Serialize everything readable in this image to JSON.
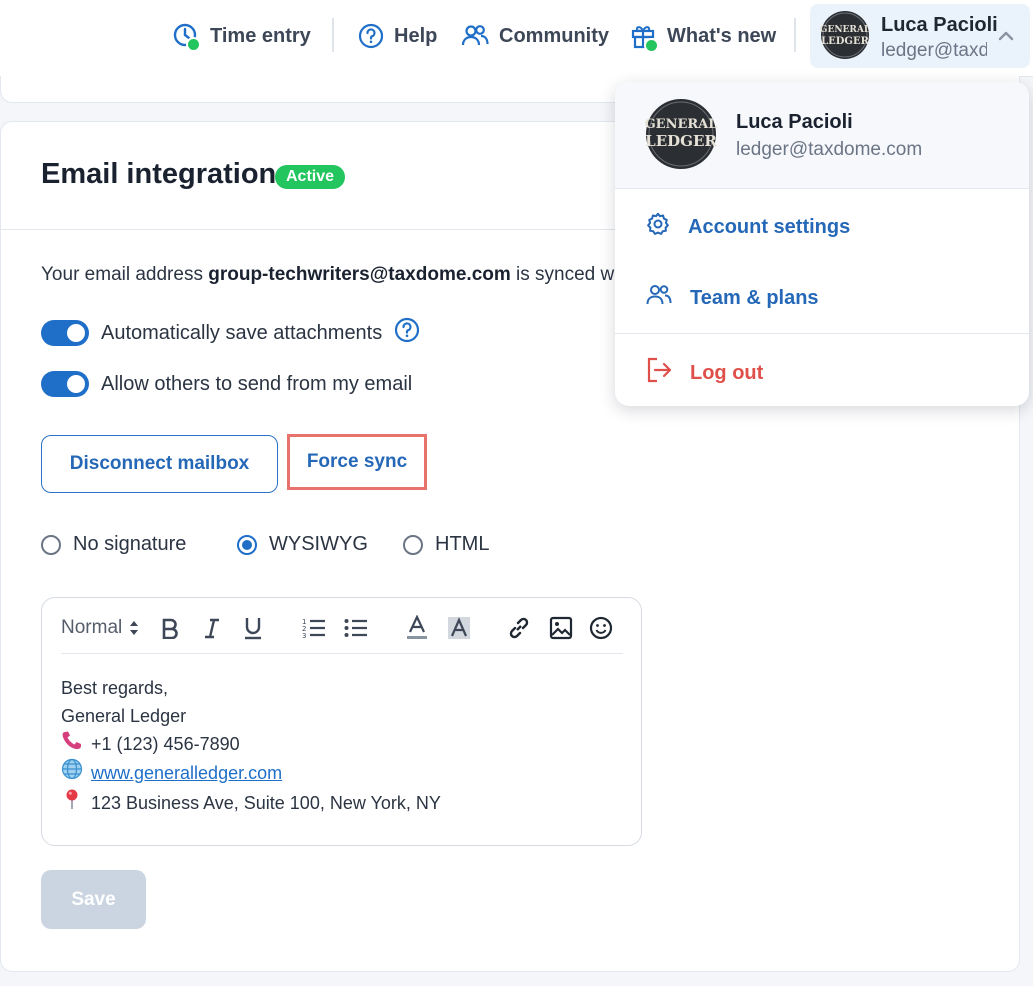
{
  "topbar": {
    "time_entry": "Time entry",
    "help": "Help",
    "community": "Community",
    "whats_new": "What's new",
    "user_name": "Luca Pacioli",
    "user_email": "ledger@taxdome.com",
    "avatar_text_top": "GENERAL",
    "avatar_text_bottom": "LEDGER"
  },
  "email_integration": {
    "title": "Email integration",
    "badge": "Active",
    "synced_prefix": "Your email address ",
    "synced_email": "group-techwriters@taxdome.com",
    "synced_suffix": " is synced w",
    "toggle_save_attachments": "Automatically save attachments",
    "toggle_allow_others": "Allow others to send from my email",
    "disconnect_button": "Disconnect mailbox",
    "force_sync_button": "Force sync",
    "signature_options": [
      "No signature",
      "WYSIWYG",
      "HTML"
    ],
    "selected_signature": "WYSIWYG",
    "save_button": "Save"
  },
  "editor": {
    "format_select": "Normal",
    "lines": {
      "greeting": "Best regards,",
      "company": "General Ledger",
      "phone": "+1 (123) 456-7890",
      "website": "www.generalledger.com",
      "address": "123 Business Ave, Suite 100, New York, NY"
    }
  },
  "dropdown": {
    "name": "Luca Pacioli",
    "email": "ledger@taxdome.com",
    "account_settings": "Account settings",
    "team_plans": "Team & plans",
    "log_out": "Log out"
  },
  "colors": {
    "accent": "#1f6fc9",
    "active_badge": "#22c55e",
    "logout_red": "#e0504a",
    "highlight_border": "#e8736c",
    "save_disabled": "#cbd5e1"
  }
}
